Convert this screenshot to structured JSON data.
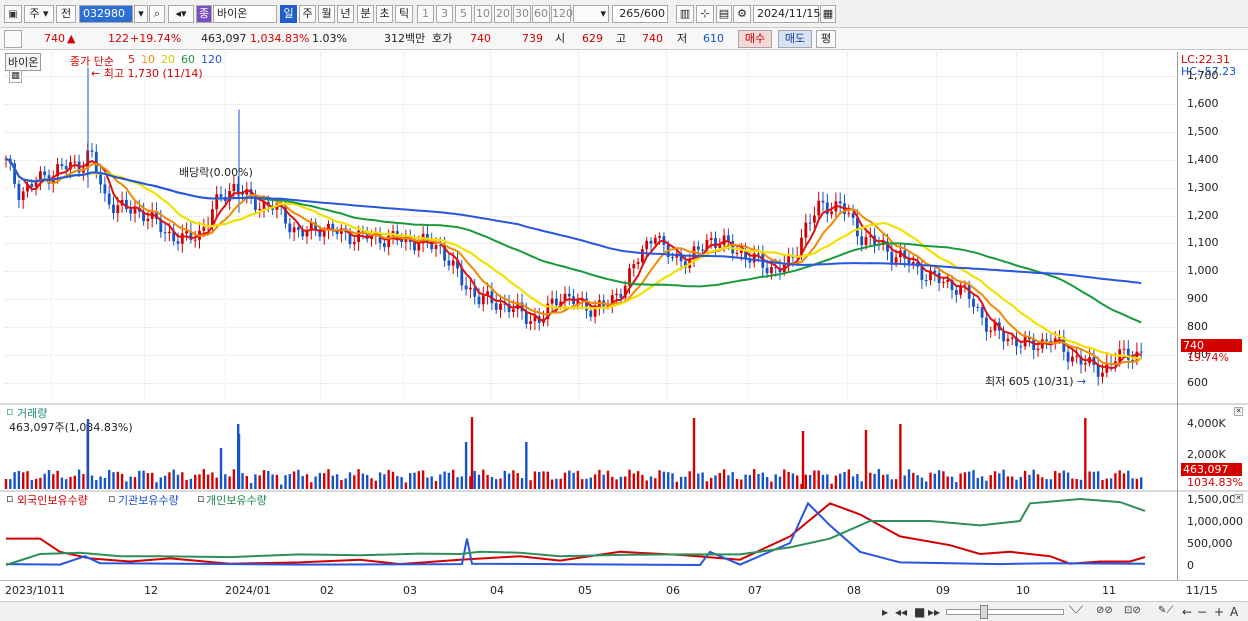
{
  "toolbar": {
    "chart_type_label": "주",
    "prev_label": "전",
    "code_value": "032980",
    "name_value": "바이온",
    "name_prefix": "종",
    "period_buttons": [
      "일",
      "주",
      "월",
      "년",
      "분",
      "초",
      "틱"
    ],
    "interval_buttons": [
      "1",
      "3",
      "5",
      "10",
      "20",
      "30",
      "60",
      "120"
    ],
    "count_display": "265",
    "count_total": "/600",
    "date_value": "2024/11/15"
  },
  "quote": {
    "price": "740",
    "change_arrow": "▲",
    "change": "122",
    "change_rate": "+19.74%",
    "volume": "463,097",
    "volume_ratio": "1,034.83%",
    "turnover": "1.03%",
    "amount": "312백만",
    "hoga_label": "호가",
    "hoga_ask": "740",
    "hoga_bid": "739",
    "open_label": "시",
    "open": "629",
    "high_label": "고",
    "high": "740",
    "low_label": "저",
    "low": "610",
    "buy_label": "매수",
    "sell_label": "매도",
    "avg_label": "평"
  },
  "price_panel": {
    "title_tag": "바이온",
    "legend_prefix": "종가 단순",
    "ma_periods": [
      "5",
      "10",
      "20",
      "60",
      "120"
    ],
    "ma_colors": [
      "#e01010",
      "#f08a00",
      "#f2e100",
      "#1a9a3a",
      "#2756e0"
    ],
    "annotation_high": "최고 1,730 (11/14)",
    "annotation_div": "배당락(0.00%)",
    "annotation_low": "최저 605 (10/31)",
    "lc_label": "LC:22.31",
    "hc_label": "HC:-57.23",
    "last_price_tag": "740",
    "last_change_tag": "19.74%",
    "y_ticks": [
      "1,700",
      "1,600",
      "1,500",
      "1,400",
      "1,300",
      "1,200",
      "1,100",
      "1,000",
      "900",
      "800",
      "700",
      "600"
    ]
  },
  "volume_panel": {
    "title": "거래량",
    "value_text": "463,097주(1,034.83%)",
    "y_ticks": [
      "4,000K",
      "2,000K"
    ],
    "last_tag": "463,097",
    "last_ratio_tag": "1034.83%"
  },
  "holding_panel": {
    "legend": [
      "외국인보유수량",
      "기관보유수량",
      "개인보유수량"
    ],
    "legend_colors": [
      "#d40000",
      "#1553c9",
      "#1a8a4a"
    ],
    "y_ticks": [
      "1,500,000",
      "1,000,000",
      "500,000",
      "0"
    ]
  },
  "x_axis": {
    "labels": [
      "2023/10",
      "11",
      "12",
      "2024/01",
      "02",
      "03",
      "04",
      "05",
      "06",
      "07",
      "08",
      "09",
      "10",
      "11",
      "11/15"
    ]
  }
}
